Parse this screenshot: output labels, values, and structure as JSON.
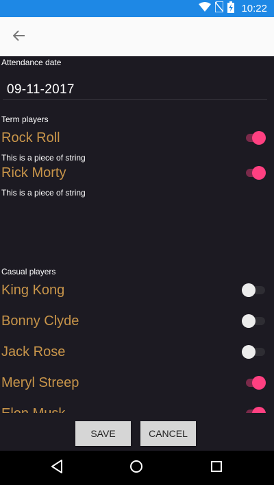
{
  "status_bar": {
    "time": "10:22",
    "icons": [
      "wifi-icon",
      "no-sim-icon",
      "battery-charging-icon"
    ],
    "color": "#1e88e5"
  },
  "app_bar": {
    "back_icon": "arrow-left-icon"
  },
  "attendance": {
    "label": "Attendance date",
    "date": "09-11-2017"
  },
  "term_players": {
    "label": "Term players",
    "items": [
      {
        "name": "Rock Roll",
        "subtitle": "This is a piece of string",
        "checked": true
      },
      {
        "name": "Rick Morty",
        "subtitle": "This is a piece of string",
        "checked": true
      }
    ]
  },
  "casual_players": {
    "label": "Casual players",
    "items": [
      {
        "name": "King Kong",
        "checked": false
      },
      {
        "name": "Bonny Clyde",
        "checked": false
      },
      {
        "name": "Jack Rose",
        "checked": false
      },
      {
        "name": "Meryl Streep",
        "checked": true
      },
      {
        "name": "Elon Musk",
        "checked": true
      }
    ]
  },
  "actions": {
    "save_label": "SAVE",
    "cancel_label": "CANCEL"
  },
  "colors": {
    "accent": "#ff4081",
    "player_name": "#c8954a",
    "background": "#1c1a22"
  },
  "nav_bar": {
    "icons": [
      "back-triangle-icon",
      "home-circle-icon",
      "recents-square-icon"
    ]
  }
}
